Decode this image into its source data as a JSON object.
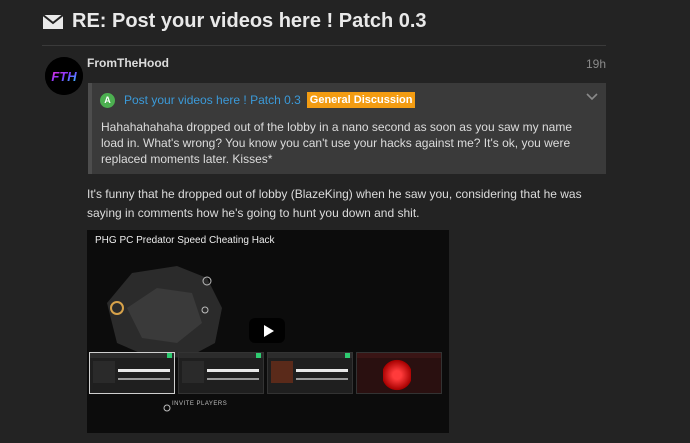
{
  "topic": {
    "title": "RE: Post your videos here ! Patch 0.3",
    "icon": "mail-icon"
  },
  "post": {
    "username": "FromTheHood",
    "age": "19h",
    "avatar_text": "FTH",
    "quote": {
      "avatar_letter": "A",
      "topic_link": "Post your videos here ! Patch 0.3",
      "category": "General Discussion",
      "category_color": "#f39c12",
      "text": "Hahahahahaha dropped out of the lobby in a nano second as soon as you saw my name load in. What's wrong? You know you can't use your hacks against me? It's ok, you were replaced moments later. Kisses*"
    },
    "body": "It's funny that he dropped out of lobby (BlazeKing) when he saw you, considering that he was saying in comments how he's going to hunt you down and shit.",
    "video": {
      "title": "PHG PC Predator Speed Cheating Hack",
      "invite_text": "INVITE PLAYERS"
    }
  },
  "colors": {
    "background": "#232323",
    "link": "#3b9ad9",
    "quote_bg": "#3a3a3a"
  }
}
